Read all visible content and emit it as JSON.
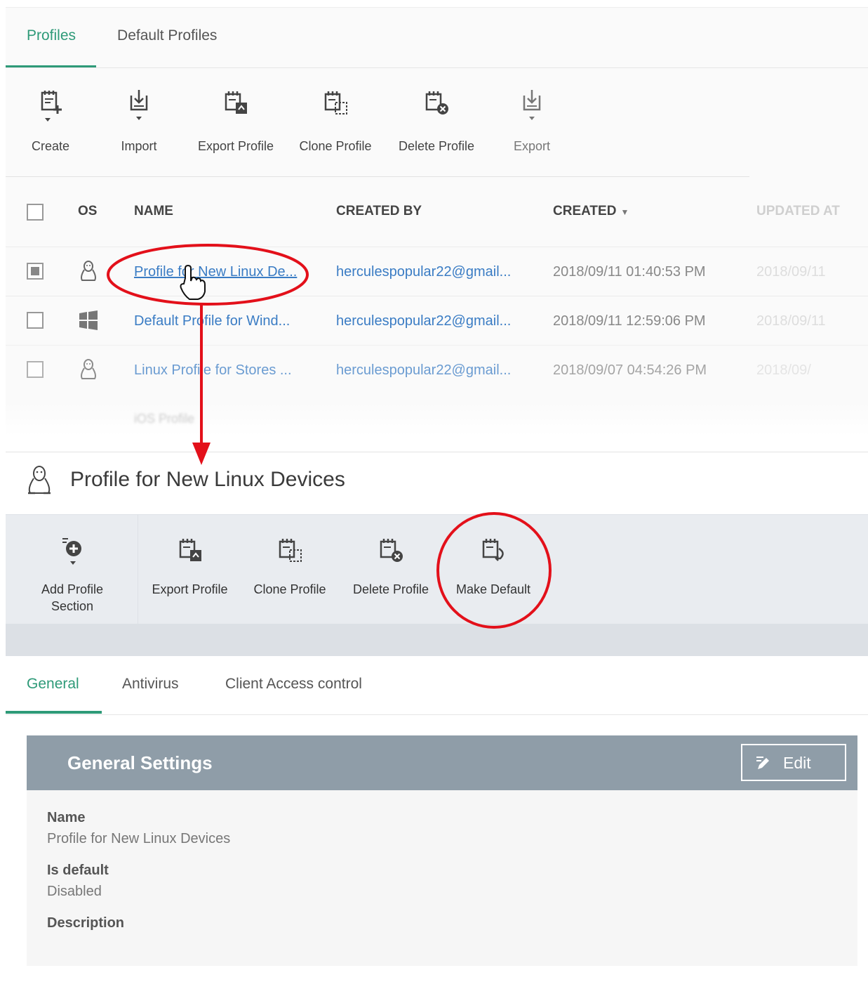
{
  "tabs": [
    {
      "label": "Profiles",
      "active": true
    },
    {
      "label": "Default Profiles",
      "active": false
    }
  ],
  "toolbar": {
    "create": "Create",
    "import": "Import",
    "export_profile": "Export Profile",
    "clone_profile": "Clone Profile",
    "delete_profile": "Delete Profile",
    "export": "Export"
  },
  "table": {
    "headers": {
      "os": "OS",
      "name": "NAME",
      "created_by": "CREATED BY",
      "created": "CREATED",
      "updated_at": "UPDATED AT"
    },
    "rows": [
      {
        "os": "linux",
        "name": "Profile for New Linux De...",
        "created_by": "herculespopular22@gmail...",
        "created": "2018/09/11 01:40:53 PM",
        "updated": "2018/09/11",
        "checked": true
      },
      {
        "os": "windows",
        "name": "Default Profile for Wind...",
        "created_by": "herculespopular22@gmail...",
        "created": "2018/09/11 12:59:06 PM",
        "updated": "2018/09/11",
        "checked": false
      },
      {
        "os": "linux",
        "name": "Linux Profile for Stores ...",
        "created_by": "herculespopular22@gmail...",
        "created": "2018/09/07 04:54:26 PM",
        "updated": "2018/09/",
        "checked": false
      }
    ],
    "partial_row_name": "iOS Profile"
  },
  "detail": {
    "title": "Profile for New Linux Devices",
    "os_icon": "linux-icon",
    "toolbar": {
      "add_section_line1": "Add Profile",
      "add_section_line2": "Section",
      "export_profile": "Export Profile",
      "clone_profile": "Clone Profile",
      "delete_profile": "Delete Profile",
      "make_default": "Make Default"
    },
    "tabs": [
      {
        "label": "General",
        "active": true
      },
      {
        "label": "Antivirus",
        "active": false
      },
      {
        "label": "Client Access control",
        "active": false
      }
    ],
    "general": {
      "heading": "General Settings",
      "edit_label": "Edit",
      "name_label": "Name",
      "name_value": "Profile for New Linux Devices",
      "default_label": "Is default",
      "default_value": "Disabled",
      "description_label": "Description"
    }
  },
  "colors": {
    "accent_green": "#2e9a78",
    "link_blue": "#3a7cc4",
    "annotation_red": "#e3101a",
    "panel_header": "#8f9da8"
  }
}
